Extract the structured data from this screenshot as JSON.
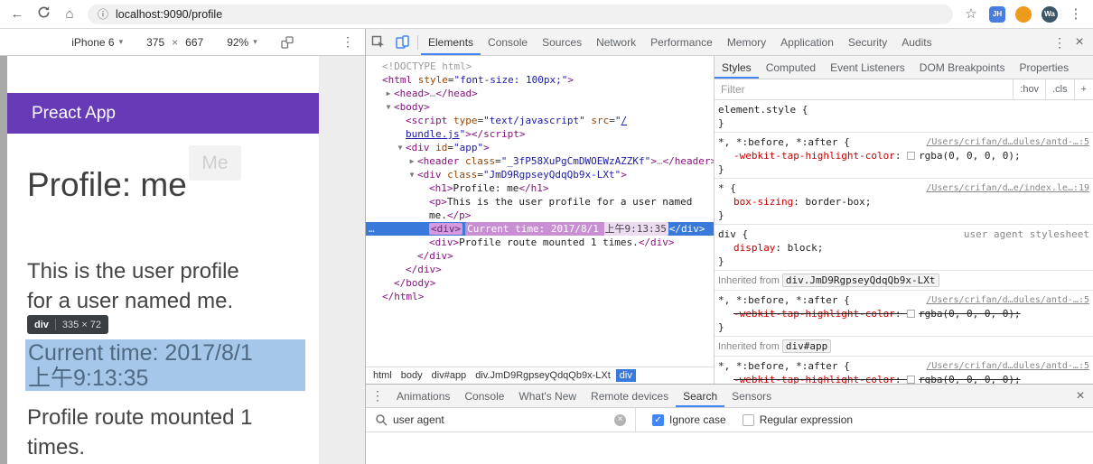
{
  "colors": {
    "accent": "#4285f4",
    "preact_purple": "#673ab8",
    "selection_blue": "#3879d9",
    "element_highlight_overlay": "#a5c7e9",
    "mutation_flash_pink": "#c98fd3"
  },
  "icons": {
    "back": "←",
    "home": "⌂",
    "star": "☆",
    "info": "ⓘ",
    "menu": "⋮",
    "close": "×",
    "caret": "▾",
    "clear": "×",
    "check": "✓",
    "ellipsis": "…"
  },
  "browser": {
    "url": "localhost:9090/profile",
    "ext_badge_1": "JH",
    "ext_badge_3": "Wa"
  },
  "emulation": {
    "device": "iPhone 6",
    "width": "375",
    "times": "×",
    "height": "667",
    "zoom": "92%"
  },
  "page": {
    "app_title": "Preact App",
    "ghost_nav": "Me",
    "heading": "Profile: me",
    "para_line1": "This is the user profile",
    "para_line2": "for a user named me.",
    "tooltip_tag": "div",
    "tooltip_size": "335 × 72",
    "time_line1": "Current time: 2017/8/1",
    "time_line2": "上午9:13:35",
    "mounted_line1": "Profile route mounted 1",
    "mounted_line2": "times."
  },
  "devtools": {
    "main_tabs": [
      "Elements",
      "Console",
      "Sources",
      "Network",
      "Performance",
      "Memory",
      "Application",
      "Security",
      "Audits"
    ],
    "active_main_tab": "Elements",
    "sidebar_tabs": [
      "Styles",
      "Computed",
      "Event Listeners",
      "DOM Breakpoints",
      "Properties"
    ],
    "active_sidebar_tab": "Styles",
    "filter_placeholder": "Filter",
    "filter_controls": [
      ":hov",
      ".cls",
      "+"
    ]
  },
  "tree": [
    {
      "i": 0,
      "a": "",
      "t": [
        [
          "gray",
          "<!DOCTYPE html>"
        ]
      ]
    },
    {
      "i": 0,
      "a": "",
      "t": [
        [
          "tag",
          "<html"
        ],
        [
          "attr",
          " style"
        ],
        [
          "eq",
          "="
        ],
        [
          "str",
          "\"font-size: 100px;\""
        ],
        [
          "tag",
          ">"
        ]
      ]
    },
    {
      "i": 1,
      "a": "▶",
      "t": [
        [
          "tag",
          "<head>"
        ],
        [
          "gray",
          "…"
        ],
        [
          "tag",
          "</head>"
        ]
      ]
    },
    {
      "i": 1,
      "a": "▼",
      "t": [
        [
          "tag",
          "<body>"
        ]
      ]
    },
    {
      "i": 2,
      "a": "",
      "t": [
        [
          "tag",
          "<script"
        ],
        [
          "attr",
          " type"
        ],
        [
          "eq",
          "="
        ],
        [
          "str",
          "\"text/javascript\""
        ],
        [
          "attr",
          " src"
        ],
        [
          "eq",
          "="
        ],
        [
          "str",
          "\""
        ],
        [
          "link",
          "/"
        ]
      ]
    },
    {
      "i": 2,
      "a": "",
      "t": [
        [
          "link",
          "bundle.js"
        ],
        [
          "str",
          "\""
        ],
        [
          "tag",
          "></script>"
        ]
      ]
    },
    {
      "i": 2,
      "a": "▼",
      "t": [
        [
          "tag",
          "<div"
        ],
        [
          "attr",
          " id"
        ],
        [
          "eq",
          "="
        ],
        [
          "str",
          "\"app\""
        ],
        [
          "tag",
          ">"
        ]
      ]
    },
    {
      "i": 3,
      "a": "▶",
      "t": [
        [
          "tag",
          "<header"
        ],
        [
          "attr",
          " class"
        ],
        [
          "eq",
          "="
        ],
        [
          "str",
          "\"_3fP58XuPgCmDWOEWzAZZKf\""
        ],
        [
          "tag",
          ">"
        ],
        [
          "gray",
          "…"
        ],
        [
          "tag",
          "</header>"
        ]
      ]
    },
    {
      "i": 3,
      "a": "▼",
      "t": [
        [
          "tag",
          "<div"
        ],
        [
          "attr",
          " class"
        ],
        [
          "eq",
          "="
        ],
        [
          "str",
          "\"JmD9RgpseyQdqQb9x-LXt\""
        ],
        [
          "tag",
          ">"
        ]
      ]
    },
    {
      "i": 4,
      "a": "",
      "t": [
        [
          "tag",
          "<h1>"
        ],
        [
          "txt",
          "Profile: me"
        ],
        [
          "tag",
          "</h1>"
        ]
      ]
    },
    {
      "i": 4,
      "a": "",
      "t": [
        [
          "tag",
          "<p>"
        ],
        [
          "txt",
          "This is the user profile for a user named"
        ]
      ]
    },
    {
      "i": 4,
      "a": "",
      "t": [
        [
          "txt",
          "me."
        ],
        [
          "tag",
          "</p>"
        ]
      ]
    },
    {
      "i": 4,
      "a": "",
      "sel": true,
      "g": true,
      "t": [
        [
          "selchip",
          "<div>"
        ],
        [
          "flash",
          "Current time: 2017/8/1 "
        ],
        [
          "flash2",
          "上午9:13:35"
        ],
        [
          "selwhite",
          "</div>"
        ]
      ]
    },
    {
      "i": 4,
      "a": "",
      "t": [
        [
          "tag",
          "<div>"
        ],
        [
          "txt",
          "Profile route mounted 1 times."
        ],
        [
          "tag",
          "</div>"
        ]
      ]
    },
    {
      "i": 3,
      "a": "",
      "t": [
        [
          "tag",
          "</div>"
        ]
      ]
    },
    {
      "i": 2,
      "a": "",
      "t": [
        [
          "tag",
          "</div>"
        ]
      ]
    },
    {
      "i": 1,
      "a": "",
      "t": [
        [
          "tag",
          "</body>"
        ]
      ]
    },
    {
      "i": 0,
      "a": "",
      "t": [
        [
          "tag",
          "</html>"
        ]
      ]
    }
  ],
  "breadcrumbs": {
    "items": [
      "html",
      "body",
      "div#app",
      "div.JmD9RgpseyQdqQb9x-LXt",
      "div"
    ],
    "selected_index": 4
  },
  "styles": {
    "sections": [
      {
        "type": "rule",
        "selector": "element.style",
        "link": "",
        "props": []
      },
      {
        "type": "rule",
        "selector": "*, *:before, *:after",
        "link": "/Users/crifan/d…dules/antd-…:5",
        "props": [
          {
            "n": "-webkit-tap-highlight-color",
            "v": "rgba(0, 0, 0, 0)",
            "swatch": true,
            "struck": false
          }
        ]
      },
      {
        "type": "rule",
        "selector": "*",
        "link": "/Users/crifan/d…e/index.le…:19",
        "props": [
          {
            "n": "box-sizing",
            "v": "border-box",
            "swatch": false,
            "struck": false
          }
        ]
      },
      {
        "type": "rule",
        "selector": "div",
        "link": "user agent stylesheet",
        "plain_link": true,
        "props": [
          {
            "n": "display",
            "v": "block",
            "swatch": false,
            "struck": false
          }
        ]
      },
      {
        "type": "inherited",
        "label": "Inherited from",
        "node": "div.JmD9RgpseyQdqQb9x-LXt"
      },
      {
        "type": "rule",
        "selector": "*, *:before, *:after",
        "link": "/Users/crifan/d…dules/antd-…:5",
        "props": [
          {
            "n": "-webkit-tap-highlight-color",
            "v": "rgba(0, 0, 0, 0)",
            "swatch": true,
            "struck": true
          }
        ]
      },
      {
        "type": "inherited",
        "label": "Inherited from",
        "node": "div#app"
      },
      {
        "type": "rule",
        "selector": "*, *:before, *:after",
        "link": "/Users/crifan/d…dules/antd-…:5",
        "props": [
          {
            "n": "-webkit-tap-highlight-color",
            "v": "rgba(0, 0, 0, 0)",
            "swatch": true,
            "struck": true
          }
        ]
      }
    ]
  },
  "drawer": {
    "tabs": [
      "Animations",
      "Console",
      "What's New",
      "Remote devices",
      "Search",
      "Sensors"
    ],
    "active_tab": "Search",
    "search_query": "user agent",
    "ignore_case_label": "Ignore case",
    "ignore_case_checked": true,
    "regex_label": "Regular expression",
    "regex_checked": false
  }
}
